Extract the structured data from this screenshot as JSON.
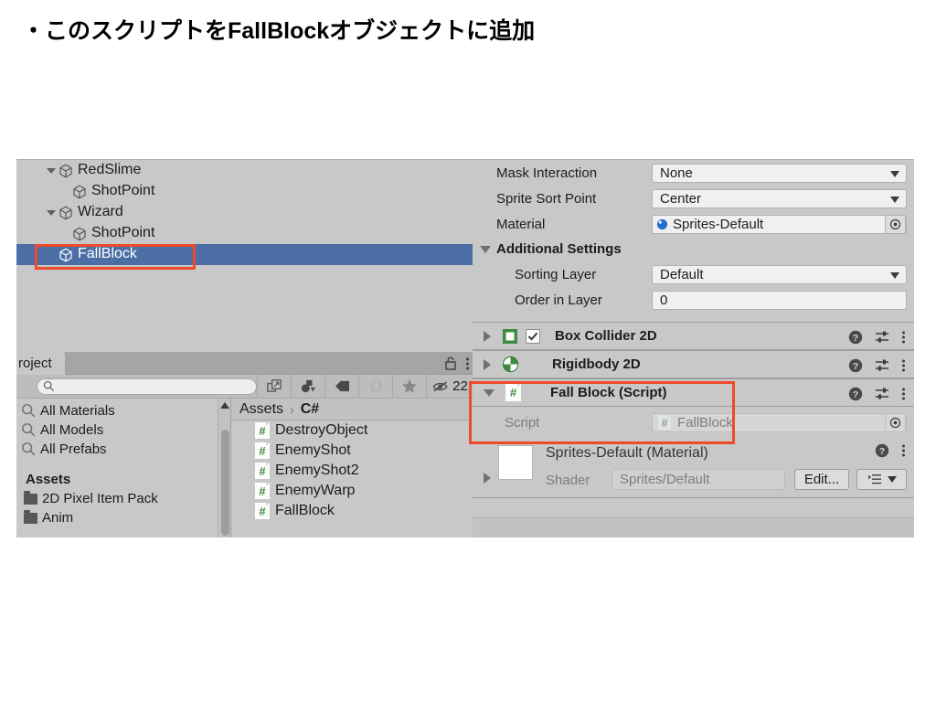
{
  "slide": {
    "title": "・このスクリプトをFallBlockオブジェクトに追加"
  },
  "hierarchy": {
    "rows": [
      {
        "label": "RedSlime",
        "indent": 1,
        "expanded": true,
        "selected": false
      },
      {
        "label": "ShotPoint",
        "indent": 2,
        "expanded": null,
        "selected": false
      },
      {
        "label": "Wizard",
        "indent": 1,
        "expanded": true,
        "selected": false
      },
      {
        "label": "ShotPoint",
        "indent": 2,
        "expanded": null,
        "selected": false
      },
      {
        "label": "FallBlock",
        "indent": 2,
        "expanded": null,
        "selected": true
      }
    ]
  },
  "project": {
    "tab_label": "roject",
    "lock_icon": "lock-icon",
    "menu_icon": "kebab-menu-icon",
    "search": {
      "placeholder": "",
      "value": "",
      "icon": "search-icon"
    },
    "toolbar": {
      "expand_icon": "expand-search-icon",
      "type_filter_icon": "asset-type-filter-icon",
      "label_filter_icon": "label-filter-icon",
      "warning_icon": "warning-filter-icon",
      "favorite_icon": "star-favorite-icon",
      "hidden_icon": "hidden-eye-icon",
      "hidden_count": "22"
    },
    "tree": [
      {
        "label": "All Materials",
        "type": "search"
      },
      {
        "label": "All Models",
        "type": "search"
      },
      {
        "label": "All Prefabs",
        "type": "search"
      },
      {
        "label": "Assets",
        "type": "header"
      },
      {
        "label": "2D Pixel Item Pack",
        "type": "folder"
      },
      {
        "label": "Anim",
        "type": "folder"
      }
    ],
    "breadcrumb": {
      "root": "Assets",
      "separator": "›",
      "current": "C#"
    },
    "assets": [
      {
        "name": "DestroyObject",
        "icon": "csharp-script-icon"
      },
      {
        "name": "EnemyShot",
        "icon": "csharp-script-icon"
      },
      {
        "name": "EnemyShot2",
        "icon": "csharp-script-icon"
      },
      {
        "name": "EnemyWarp",
        "icon": "csharp-script-icon"
      },
      {
        "name": "FallBlock",
        "icon": "csharp-script-icon"
      }
    ]
  },
  "inspector": {
    "sprite_renderer_fields": [
      {
        "label": "Mask Interaction",
        "value": "None",
        "control": "dropdown"
      },
      {
        "label": "Sprite Sort Point",
        "value": "Center",
        "control": "dropdown"
      },
      {
        "label": "Material",
        "value": "Sprites-Default",
        "control": "object"
      }
    ],
    "additional_settings": {
      "title": "Additional Settings",
      "fields": [
        {
          "label": "Sorting Layer",
          "value": "Default",
          "control": "dropdown"
        },
        {
          "label": "Order in Layer",
          "value": "0",
          "control": "text"
        }
      ]
    },
    "components": [
      {
        "title": "Box Collider 2D",
        "icon": "box-collider-2d-icon",
        "expanded": false,
        "has_checkbox": true,
        "checked": true
      },
      {
        "title": "Rigidbody 2D",
        "icon": "rigidbody-2d-icon",
        "expanded": false,
        "has_checkbox": false
      },
      {
        "title": "Fall Block (Script)",
        "icon": "csharp-script-icon",
        "expanded": true,
        "has_checkbox": false
      }
    ],
    "script_row": {
      "label": "Script",
      "value": "FallBlock",
      "icon": "csharp-script-icon",
      "picker_icon": "object-picker-icon"
    },
    "component_action_icons": {
      "help": "help-icon",
      "preset": "preset-icon",
      "menu": "kebab-menu-icon"
    },
    "material": {
      "title": "Sprites-Default (Material)",
      "shader_label": "Shader",
      "shader_value": "Sprites/Default",
      "edit_button": "Edit...",
      "preset_icon": "preset-list-icon",
      "help_icon": "help-icon",
      "menu_icon": "kebab-menu-icon",
      "swatch_color": "#ffffff"
    }
  },
  "annotations": [
    {
      "name": "hierarchy-fallblock-highlight",
      "color": "#ef4a2a"
    },
    {
      "name": "fall-block-script-highlight",
      "color": "#ef4a2a"
    }
  ],
  "colors": {
    "panel_bg": "#c8c8c8",
    "selection_blue": "#4b6fa5",
    "annotation_red": "#ef4a2a",
    "unity_green": "#3f8c3f"
  }
}
